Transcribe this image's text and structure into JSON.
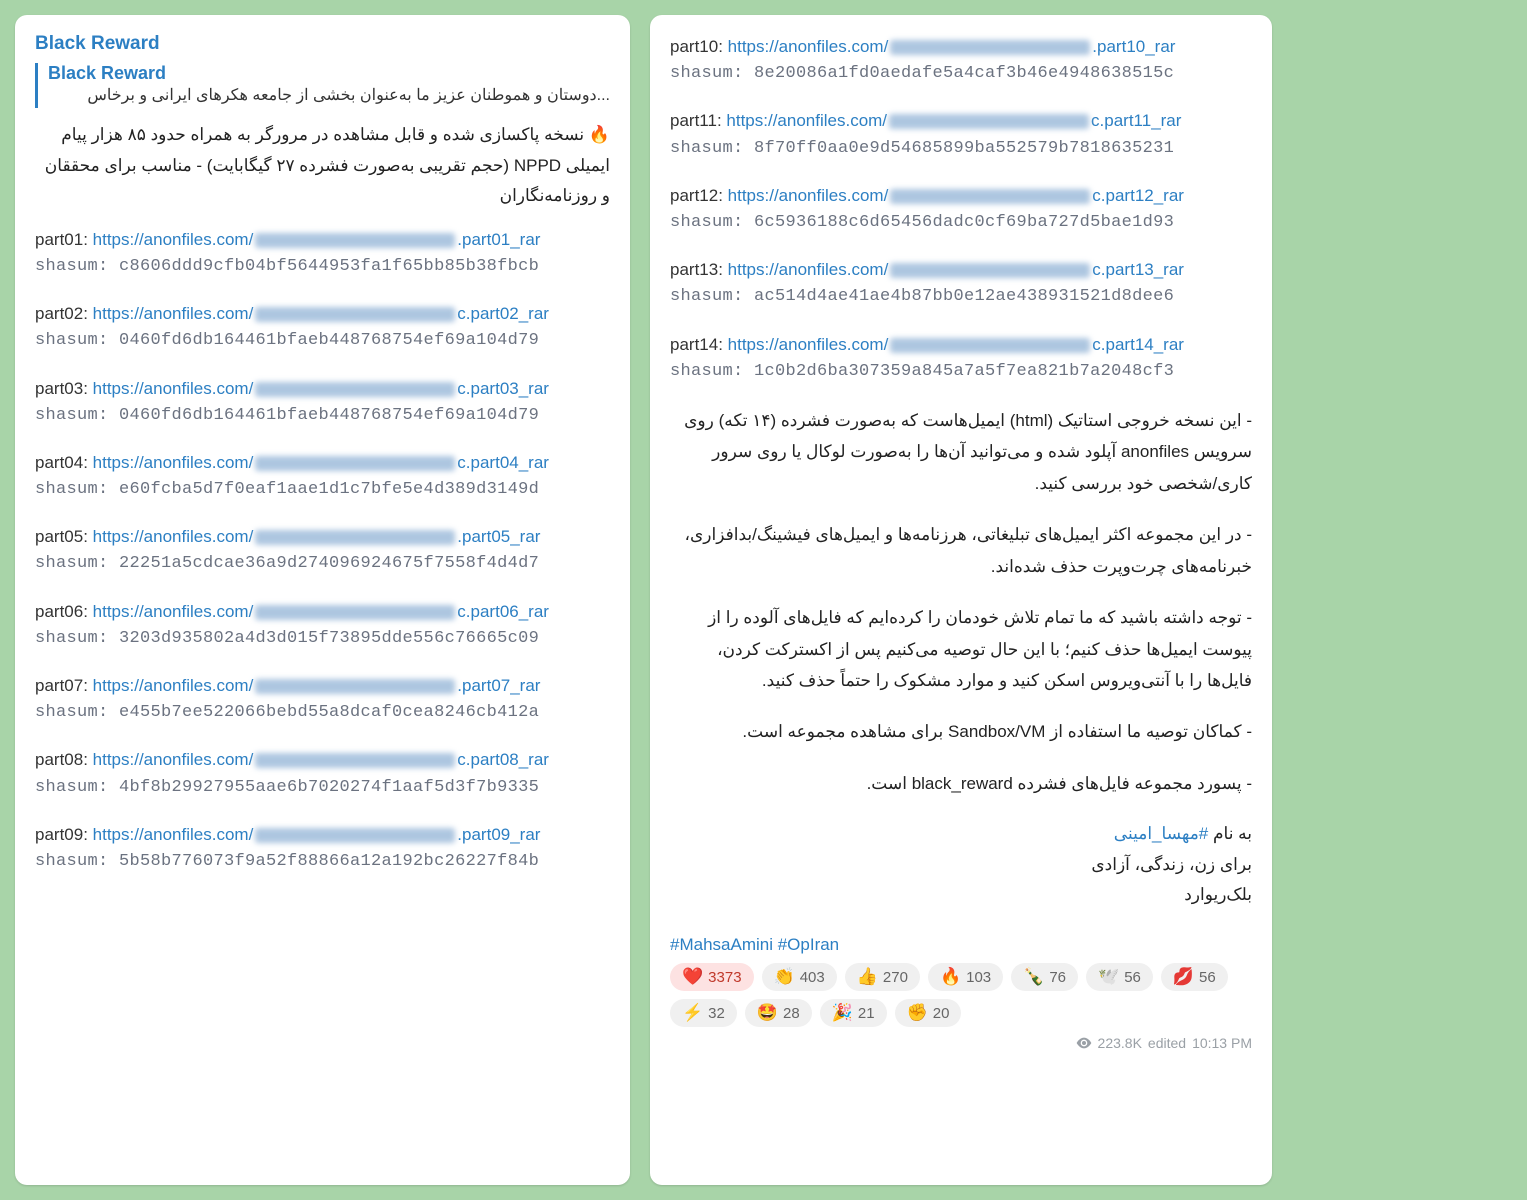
{
  "left": {
    "channel": "Black Reward",
    "reply_title": "Black Reward",
    "reply_snippet": "...دوستان و هموطنان عزیز ما به‌عنوان بخشی از جامعه هکرهای ایرانی و برخاس",
    "intro": "🔥 نسخه پاکسازی شده و قابل مشاهده در مرورگر به همراه حدود ۸۵ هزار پیام ایمیلی NPPD (حجم تقریبی به‌صورت فشرده ۲۷ گیگابایت) - مناسب برای محققان و روزنامه‌نگاران",
    "url_base_prefix": "https://anonfiles.com/",
    "parts": [
      {
        "n": "01",
        "suffix": ".part01_rar",
        "sha": "c8606ddd9cfb04bf5644953fa1f65bb85b38fbcb"
      },
      {
        "n": "02",
        "suffix": "c.part02_rar",
        "sha": "0460fd6db164461bfaeb448768754ef69a104d79"
      },
      {
        "n": "03",
        "suffix": "c.part03_rar",
        "sha": "0460fd6db164461bfaeb448768754ef69a104d79"
      },
      {
        "n": "04",
        "suffix": "c.part04_rar",
        "sha": "e60fcba5d7f0eaf1aae1d1c7bfe5e4d389d3149d"
      },
      {
        "n": "05",
        "suffix": ".part05_rar",
        "sha": "22251a5cdcae36a9d274096924675f7558f4d4d7"
      },
      {
        "n": "06",
        "suffix": "c.part06_rar",
        "sha": "3203d935802a4d3d015f73895dde556c76665c09"
      },
      {
        "n": "07",
        "suffix": ".part07_rar",
        "sha": "e455b7ee522066bebd55a8dcaf0cea8246cb412a"
      },
      {
        "n": "08",
        "suffix": "c.part08_rar",
        "sha": "4bf8b29927955aae6b7020274f1aaf5d3f7b9335"
      },
      {
        "n": "09",
        "suffix": ".part09_rar",
        "sha": "5b58b776073f9a52f88866a12a192bc26227f84b"
      }
    ]
  },
  "right": {
    "url_base_prefix": "https://anonfiles.com/",
    "parts": [
      {
        "n": "10",
        "suffix": ".part10_rar",
        "sha": "8e20086a1fd0aedafe5a4caf3b46e4948638515c"
      },
      {
        "n": "11",
        "suffix": "c.part11_rar",
        "sha": "8f70ff0aa0e9d54685899ba552579b7818635231"
      },
      {
        "n": "12",
        "suffix": "c.part12_rar",
        "sha": "6c5936188c6d65456dadc0cf69ba727d5bae1d93"
      },
      {
        "n": "13",
        "suffix": "c.part13_rar",
        "sha": "ac514d4ae41ae4b87bb0e12ae438931521d8dee6"
      },
      {
        "n": "14",
        "suffix": "c.part14_rar",
        "sha": "1c0b2d6ba307359a845a7a5f7ea821b7a2048cf3"
      }
    ],
    "notes": [
      "- این نسخه خروجی استاتیک (html) ایمیل‌هاست که به‌صورت فشرده (۱۴ تکه) روی سرویس anonfiles آپلود شده و می‌توانید آن‌ها را به‌صورت لوکال یا روی سرور کاری/شخصی خود بررسی کنید.",
      "- در این مجموعه اکثر ایمیل‌های تبلیغاتی، هرزنامه‌ها و ایمیل‌های فیشینگ/بدافزاری، خبرنامه‌های چرت‌وپرت حذف شده‌اند.",
      "- توجه داشته باشید که ما تمام تلاش خودمان را کرده‌ایم که فایل‌های آلوده را از پیوست ایمیل‌ها حذف کنیم؛ با این حال توصیه می‌کنیم پس از اکسترکت کردن، فایل‌ها را با آنتی‌ویروس اسکن کنید و موارد مشکوک را حتماً حذف کنید.",
      "- کماکان توصیه ما استفاده از Sandbox/VM برای مشاهده مجموعه است.",
      "- پسورد مجموعه فایل‌های فشرده black_reward است."
    ],
    "sig_prefix": "به نام ",
    "sig_hashtag": "#مهسا_امینی",
    "sig_line2": "برای زن، زندگی، آزادی",
    "sig_line3": "بلک‌ریوارد",
    "hashtags": "#MahsaAmini  #OpIran",
    "reactions": [
      {
        "emoji": "❤️",
        "count": "3373"
      },
      {
        "emoji": "👏",
        "count": "403"
      },
      {
        "emoji": "👍",
        "count": "270"
      },
      {
        "emoji": "🔥",
        "count": "103"
      },
      {
        "emoji": "🍾",
        "count": "76"
      },
      {
        "emoji": "🕊️",
        "count": "56"
      },
      {
        "emoji": "💋",
        "count": "56"
      },
      {
        "emoji": "⚡",
        "count": "32"
      },
      {
        "emoji": "🤩",
        "count": "28"
      },
      {
        "emoji": "🎉",
        "count": "21"
      },
      {
        "emoji": "✊",
        "count": "20"
      }
    ],
    "views": "223.8K",
    "edited": "edited",
    "time": "10:13 PM"
  },
  "labels": {
    "shasum": "shasum:",
    "part_prefix": "part"
  }
}
